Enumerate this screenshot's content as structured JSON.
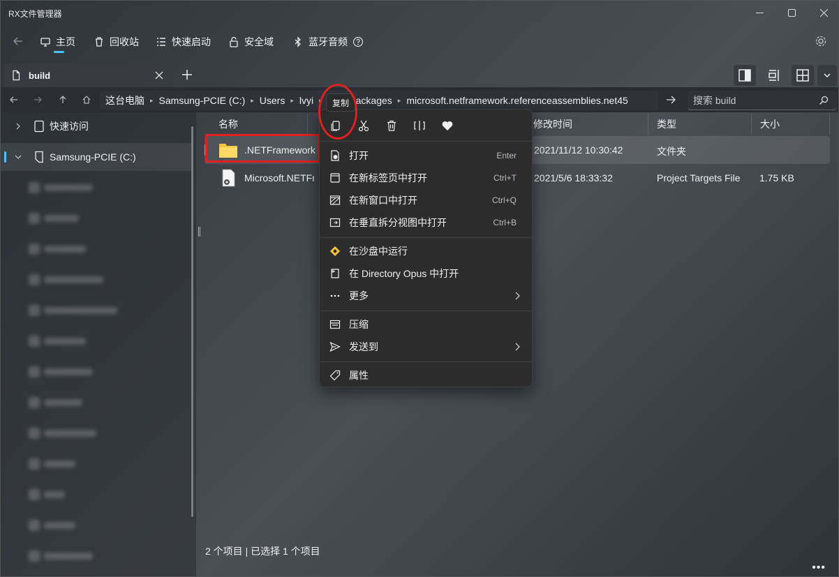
{
  "app": {
    "title": "RX文件管理器"
  },
  "toolbar": {
    "items": [
      {
        "label": "主页",
        "icon": "home-icon"
      },
      {
        "label": "回收站",
        "icon": "recycle-bin-icon"
      },
      {
        "label": "快速启动",
        "icon": "quick-launch-icon"
      },
      {
        "label": "安全域",
        "icon": "secure-area-icon"
      },
      {
        "label": "蓝牙音频",
        "icon": "bluetooth-icon"
      }
    ],
    "active_index": 0
  },
  "tabs": [
    {
      "label": "build",
      "active": true
    }
  ],
  "breadcrumb": {
    "items": [
      "这台电脑",
      "Samsung-PCIE (C:)",
      "Users",
      "lvyi",
      ".n",
      "packages",
      "microsoft.netframework.referenceassemblies.net45"
    ]
  },
  "search": {
    "placeholder": "搜索 build",
    "value": ""
  },
  "sidebar": {
    "items": [
      {
        "label": "快速访问",
        "icon": "quick-access-icon",
        "expanded": false,
        "selected": false
      },
      {
        "label": "Samsung-PCIE (C:)",
        "icon": "drive-icon",
        "expanded": true,
        "selected": true
      }
    ]
  },
  "columns": {
    "name": "名称",
    "modified": "修改时间",
    "type": "类型",
    "size": "大小"
  },
  "files": [
    {
      "name": ".NETFramework",
      "modified": "2021/11/12 10:30:42",
      "type": "文件夹",
      "size": "",
      "icon": "folder-icon",
      "selected": true
    },
    {
      "name": "Microsoft.NETFramework.ReferenceAssemblies.net45.targets",
      "modified": "2021/5/6 18:33:32",
      "type": "Project Targets File",
      "size": "1.75 KB",
      "icon": "file-settings-icon",
      "selected": false
    }
  ],
  "status": {
    "text": "2 个项目  |  已选择 1 个项目"
  },
  "context_menu": {
    "tooltip": "复制",
    "top_actions": [
      {
        "name": "copy",
        "icon": "copy-icon"
      },
      {
        "name": "cut",
        "icon": "cut-icon"
      },
      {
        "name": "delete",
        "icon": "delete-icon"
      },
      {
        "name": "rename",
        "icon": "rename-icon"
      },
      {
        "name": "favorite",
        "icon": "heart-icon"
      }
    ],
    "items": [
      {
        "label": "打开",
        "shortcut": "Enter",
        "icon": "open-icon",
        "submenu": false
      },
      {
        "label": "在新标签页中打开",
        "shortcut": "Ctrl+T",
        "icon": "new-tab-icon",
        "submenu": false
      },
      {
        "label": "在新窗口中打开",
        "shortcut": "Ctrl+Q",
        "icon": "new-window-icon",
        "submenu": false
      },
      {
        "label": "在垂直拆分视图中打开",
        "shortcut": "Ctrl+B",
        "icon": "split-view-icon",
        "submenu": false
      },
      {
        "label": "在沙盘中运行",
        "shortcut": "",
        "icon": "sandbox-icon",
        "submenu": false
      },
      {
        "label": "在 Directory Opus 中打开",
        "shortcut": "",
        "icon": "directory-opus-icon",
        "submenu": false
      },
      {
        "label": "更多",
        "shortcut": "",
        "icon": "more-icon",
        "submenu": true
      },
      {
        "label": "压缩",
        "shortcut": "",
        "icon": "compress-icon",
        "submenu": false
      },
      {
        "label": "发送到",
        "shortcut": "",
        "icon": "send-to-icon",
        "submenu": true
      },
      {
        "label": "属性",
        "shortcut": "",
        "icon": "properties-icon",
        "submenu": false
      }
    ]
  },
  "colors": {
    "accent": "#4cc2ff",
    "annotation": "#e02020",
    "menu_bg": "#2c2c2c",
    "folder": "#f5c542"
  }
}
